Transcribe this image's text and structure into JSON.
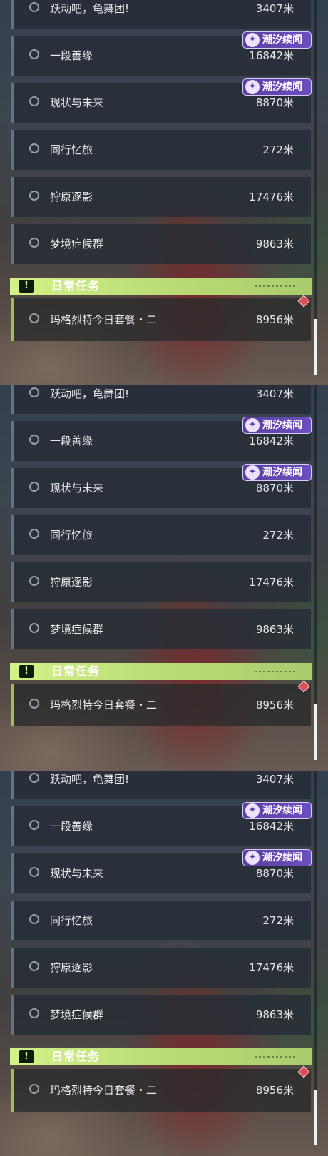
{
  "panels": [
    {
      "quests": [
        {
          "name": "跃动吧，龟舞团!",
          "distance": "3407米"
        },
        {
          "name": "一段善缘",
          "distance": "16842米"
        },
        {
          "name": "现状与未来",
          "distance": "8870米"
        },
        {
          "name": "同行忆旅",
          "distance": "272米"
        },
        {
          "name": "狩原逐影",
          "distance": "17476米"
        },
        {
          "name": "梦境症候群",
          "distance": "9863米"
        }
      ],
      "tags": [
        {
          "label": "潮汐续闻"
        },
        {
          "label": "潮汐续闻"
        }
      ],
      "daily": {
        "header_icon": "!",
        "title": "日常任务",
        "quest_name": "玛格烈特今日套餐・二",
        "distance": "8956米"
      }
    },
    {
      "quests": [
        {
          "name": "跃动吧，龟舞团!",
          "distance": "3407米"
        },
        {
          "name": "一段善缘",
          "distance": "16842米"
        },
        {
          "name": "现状与未来",
          "distance": "8870米"
        },
        {
          "name": "同行忆旅",
          "distance": "272米"
        },
        {
          "name": "狩原逐影",
          "distance": "17476米"
        },
        {
          "name": "梦境症候群",
          "distance": "9863米"
        }
      ],
      "tags": [
        {
          "label": "潮汐续闻"
        },
        {
          "label": "潮汐续闻"
        }
      ],
      "daily": {
        "header_icon": "!",
        "title": "日常任务",
        "quest_name": "玛格烈特今日套餐・二",
        "distance": "8956米"
      }
    },
    {
      "quests": [
        {
          "name": "跃动吧，龟舞团!",
          "distance": "3407米"
        },
        {
          "name": "一段善缘",
          "distance": "16842米"
        },
        {
          "name": "现状与未来",
          "distance": "8870米"
        },
        {
          "name": "同行忆旅",
          "distance": "272米"
        },
        {
          "name": "狩原逐影",
          "distance": "17476米"
        },
        {
          "name": "梦境症候群",
          "distance": "9863米"
        }
      ],
      "tags": [
        {
          "label": "潮汐续闻"
        },
        {
          "label": "潮汐续闻"
        }
      ],
      "daily": {
        "header_icon": "!",
        "title": "日常任务",
        "quest_name": "玛格烈特今日套餐・二",
        "distance": "8956米"
      }
    }
  ],
  "tag_icon": "tide-swirl-icon",
  "colors": {
    "daily_accent": "#d4f28a",
    "tag_purple": "#6c4fbf",
    "marker_red": "#d9505a"
  }
}
